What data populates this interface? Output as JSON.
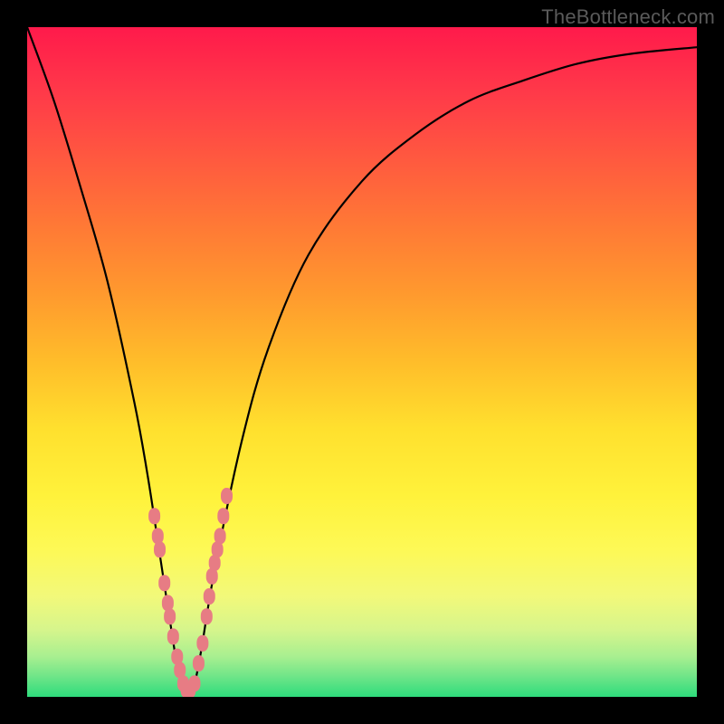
{
  "watermark": "TheBottleneck.com",
  "chart_data": {
    "type": "line",
    "title": "",
    "xlabel": "",
    "ylabel": "",
    "xlim": [
      0,
      100
    ],
    "ylim": [
      0,
      100
    ],
    "grid": false,
    "legend": false,
    "series": [
      {
        "name": "bottleneck-curve",
        "color": "#000000",
        "x": [
          0,
          4,
          8,
          12,
          16,
          18,
          20,
          22,
          23,
          24,
          25,
          26,
          28,
          32,
          36,
          42,
          50,
          58,
          66,
          74,
          82,
          90,
          100
        ],
        "y": [
          100,
          89,
          76,
          62,
          44,
          33,
          20,
          7,
          2,
          0,
          2,
          7,
          19,
          38,
          52,
          66,
          77,
          84,
          89,
          92,
          94.5,
          96,
          97
        ]
      },
      {
        "name": "marker-cluster",
        "type": "scatter",
        "color": "#e77c84",
        "x": [
          19.0,
          19.5,
          19.8,
          20.5,
          21.0,
          21.3,
          21.8,
          22.4,
          22.8,
          23.3,
          23.8,
          24.3,
          25.0,
          25.6,
          26.2,
          26.8,
          27.2,
          27.6,
          28.0,
          28.4,
          28.8,
          29.3,
          29.8
        ],
        "y": [
          27.0,
          24.0,
          22.0,
          17.0,
          14.0,
          12.0,
          9.0,
          6.0,
          4.0,
          2.0,
          1.0,
          1.0,
          2.0,
          5.0,
          8.0,
          12.0,
          15.0,
          18.0,
          20.0,
          22.0,
          24.0,
          27.0,
          30.0
        ]
      }
    ],
    "background_gradient": {
      "top": "#ff1a4b",
      "mid": "#ffe02e",
      "bottom": "#2edc7c"
    }
  }
}
